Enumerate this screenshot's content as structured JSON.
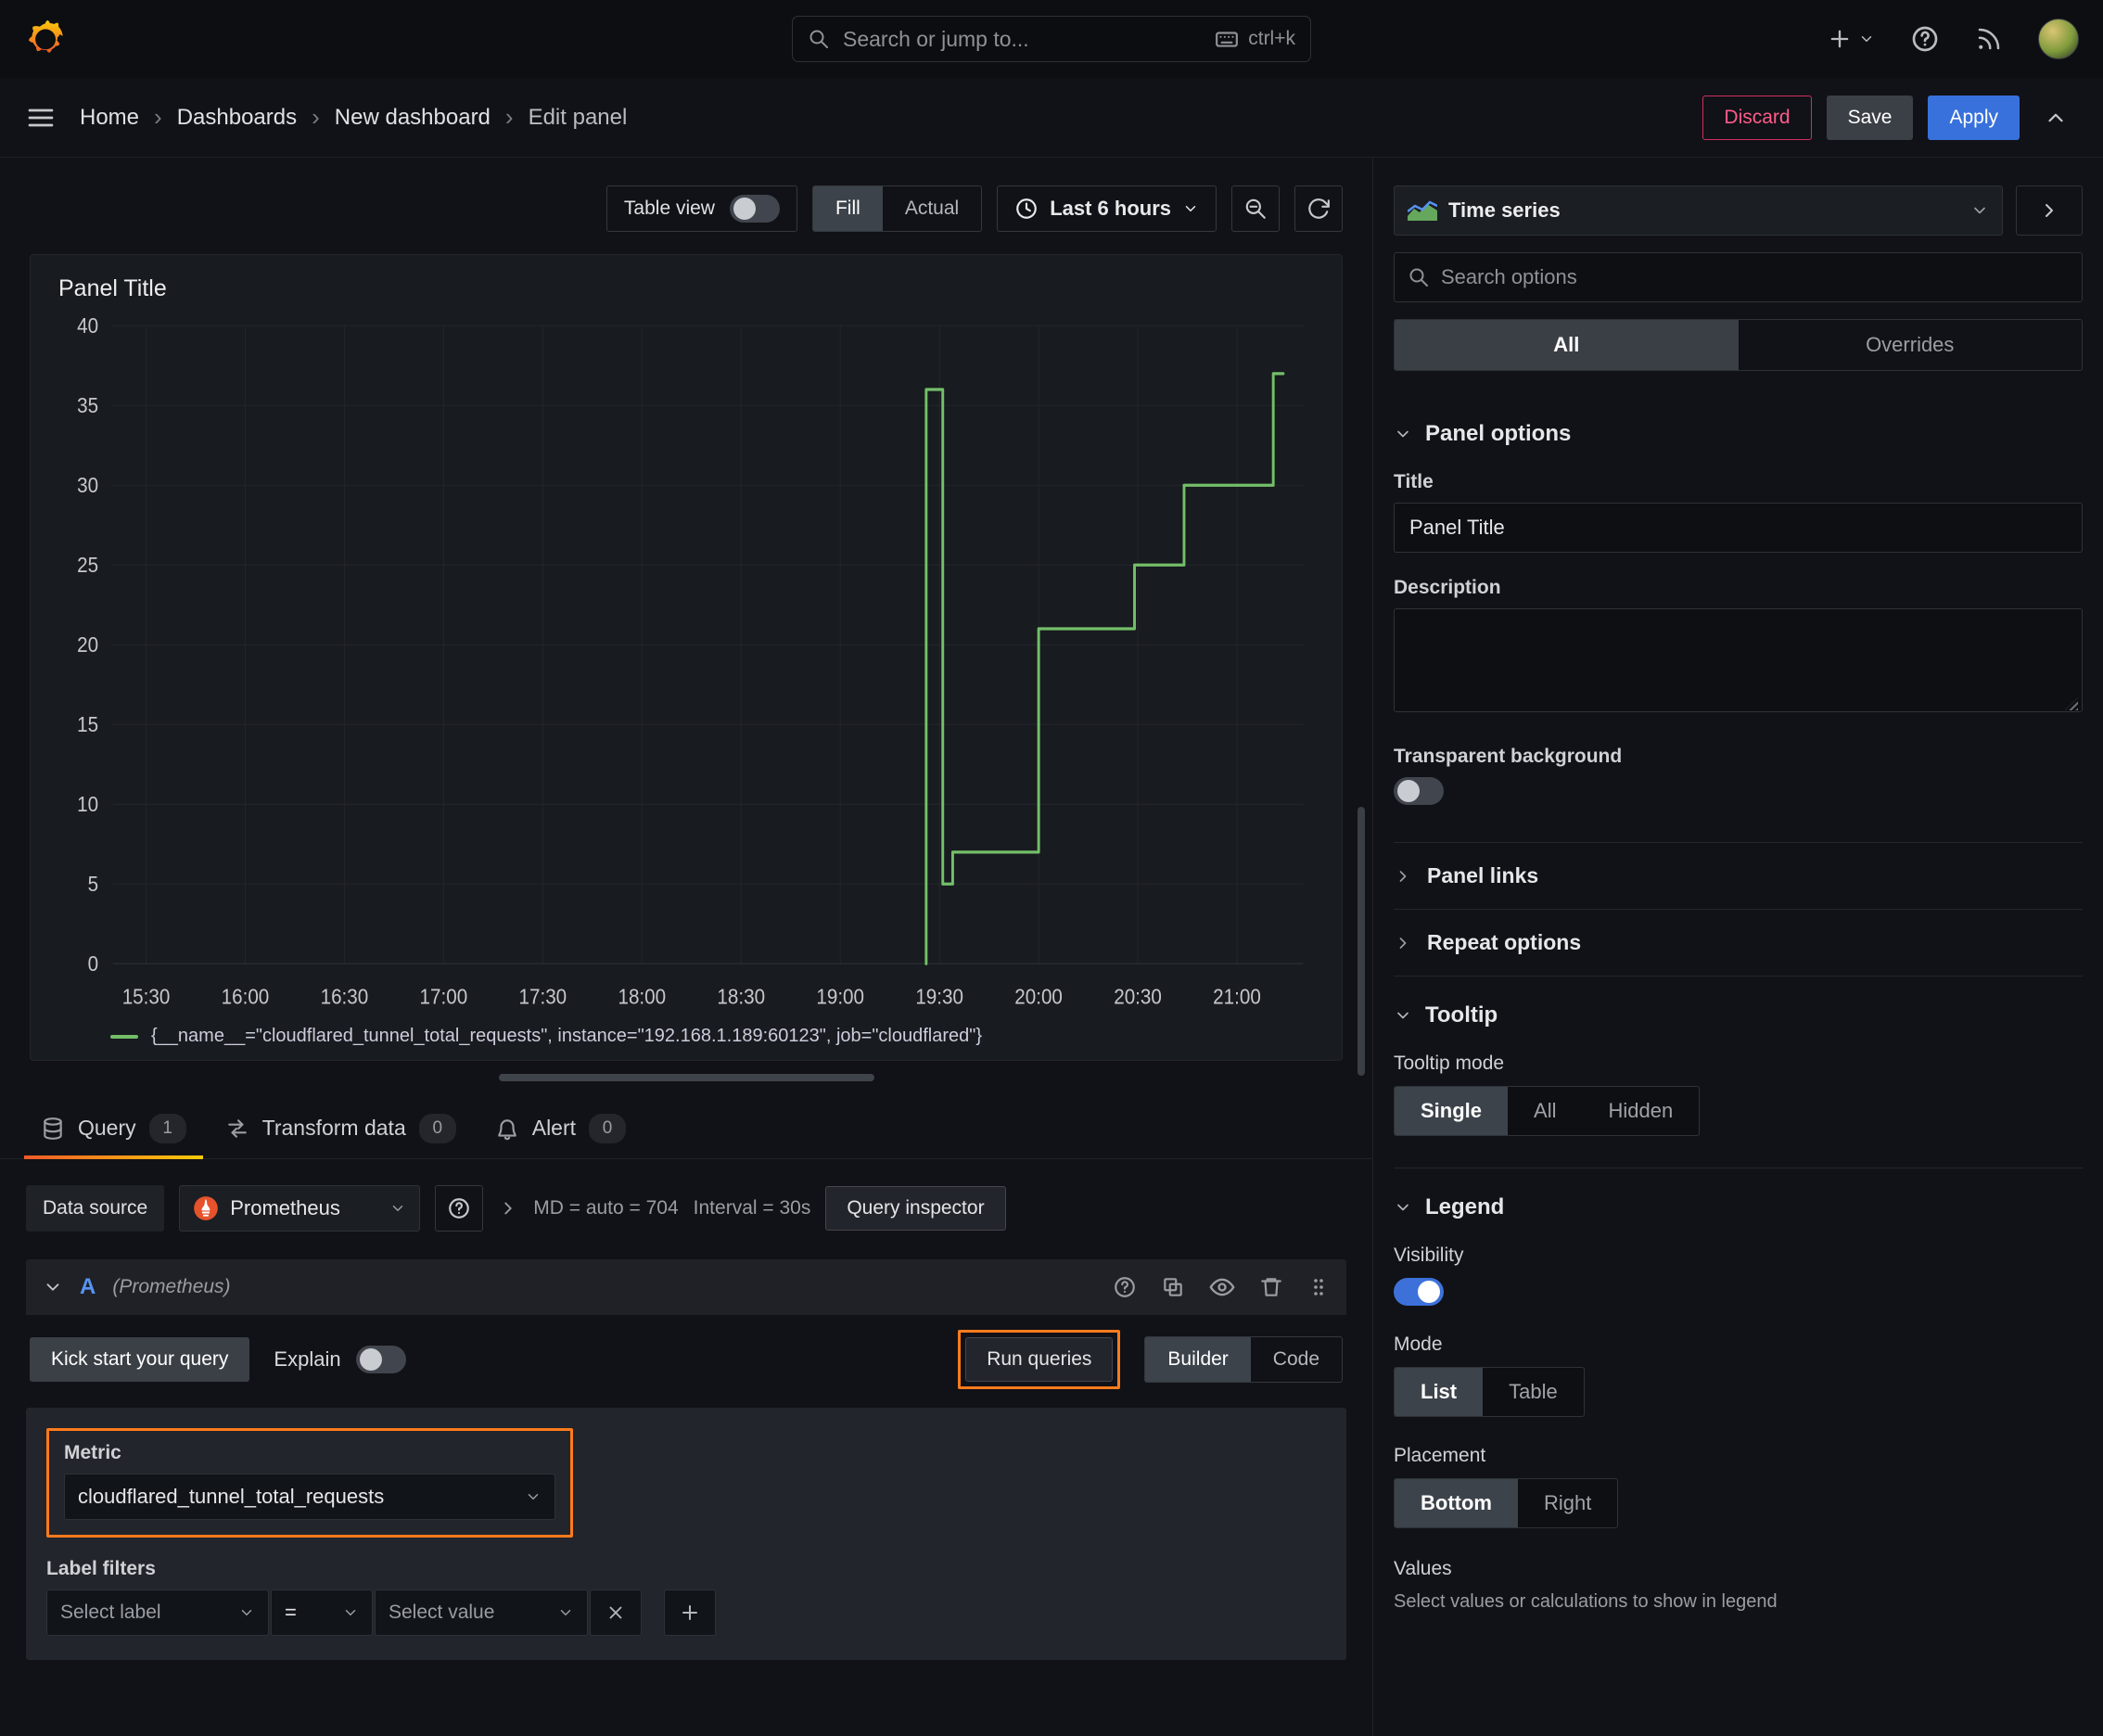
{
  "topbar": {
    "search_placeholder": "Search or jump to...",
    "search_shortcut": "ctrl+k"
  },
  "breadcrumb": {
    "items": [
      "Home",
      "Dashboards",
      "New dashboard",
      "Edit panel"
    ],
    "separator": "›"
  },
  "header_actions": {
    "discard": "Discard",
    "save": "Save",
    "apply": "Apply"
  },
  "viz_toolbar": {
    "table_view_label": "Table view",
    "fill_label": "Fill",
    "actual_label": "Actual",
    "time_range_label": "Last 6 hours"
  },
  "panel": {
    "title": "Panel Title"
  },
  "chart_data": {
    "type": "line",
    "title": "Panel Title",
    "ylim": [
      0,
      40
    ],
    "y_ticks": [
      0,
      5,
      10,
      15,
      20,
      25,
      30,
      35,
      40
    ],
    "x_domain_minutes": [
      20,
      380
    ],
    "x_ticks": [
      {
        "m": 30,
        "label": "15:30"
      },
      {
        "m": 60,
        "label": "16:00"
      },
      {
        "m": 90,
        "label": "16:30"
      },
      {
        "m": 120,
        "label": "17:00"
      },
      {
        "m": 150,
        "label": "17:30"
      },
      {
        "m": 180,
        "label": "18:00"
      },
      {
        "m": 210,
        "label": "18:30"
      },
      {
        "m": 240,
        "label": "19:00"
      },
      {
        "m": 270,
        "label": "19:30"
      },
      {
        "m": 300,
        "label": "20:00"
      },
      {
        "m": 330,
        "label": "20:30"
      },
      {
        "m": 360,
        "label": "21:00"
      }
    ],
    "grid": true,
    "legend_position": "bottom",
    "series": [
      {
        "name": "{__name__=\"cloudflared_tunnel_total_requests\", instance=\"192.168.1.189:60123\", job=\"cloudflared\"}",
        "color": "#73bf69",
        "points": [
          [
            266,
            0
          ],
          [
            266,
            36
          ],
          [
            271,
            36
          ],
          [
            271,
            5
          ],
          [
            274,
            5
          ],
          [
            274,
            7
          ],
          [
            300,
            7
          ],
          [
            300,
            21
          ],
          [
            329,
            21
          ],
          [
            329,
            25
          ],
          [
            344,
            25
          ],
          [
            344,
            30
          ],
          [
            371,
            30
          ],
          [
            371,
            37
          ],
          [
            374,
            37
          ]
        ]
      }
    ]
  },
  "editor_tabs": [
    {
      "label": "Query",
      "count": "1"
    },
    {
      "label": "Transform data",
      "count": "0"
    },
    {
      "label": "Alert",
      "count": "0"
    }
  ],
  "query_toolbar": {
    "datasource_label": "Data source",
    "datasource_value": "Prometheus",
    "md_text": "MD = auto = 704",
    "interval_text": "Interval = 30s",
    "inspector_label": "Query inspector"
  },
  "query_row": {
    "ref_id": "A",
    "datasource_hint": "(Prometheus)",
    "kick_start_label": "Kick start your query",
    "explain_label": "Explain",
    "run_queries_label": "Run queries",
    "builder_label": "Builder",
    "code_label": "Code",
    "metric_label": "Metric",
    "metric_value": "cloudflared_tunnel_total_requests",
    "label_filters_label": "Label filters",
    "select_label_placeholder": "Select label",
    "operator_value": "=",
    "select_value_placeholder": "Select value"
  },
  "options_sidebar": {
    "viz_type": "Time series",
    "search_placeholder": "Search options",
    "filter_tabs": {
      "all": "All",
      "overrides": "Overrides"
    },
    "panel_options": {
      "section_title": "Panel options",
      "title_label": "Title",
      "title_value": "Panel Title",
      "description_label": "Description",
      "transparent_label": "Transparent background",
      "panel_links_label": "Panel links",
      "repeat_options_label": "Repeat options"
    },
    "tooltip": {
      "section_title": "Tooltip",
      "mode_label": "Tooltip mode",
      "options": [
        "Single",
        "All",
        "Hidden"
      ]
    },
    "legend": {
      "section_title": "Legend",
      "visibility_label": "Visibility",
      "mode_label": "Mode",
      "mode_options": [
        "List",
        "Table"
      ],
      "placement_label": "Placement",
      "placement_options": [
        "Bottom",
        "Right"
      ],
      "values_label": "Values",
      "values_description": "Select values or calculations to show in legend"
    }
  },
  "colors": {
    "accent_orange": "#ff7b1c",
    "apply_blue": "#3871dc",
    "series_green": "#73bf69",
    "discard_red": "#ff5c8a"
  }
}
